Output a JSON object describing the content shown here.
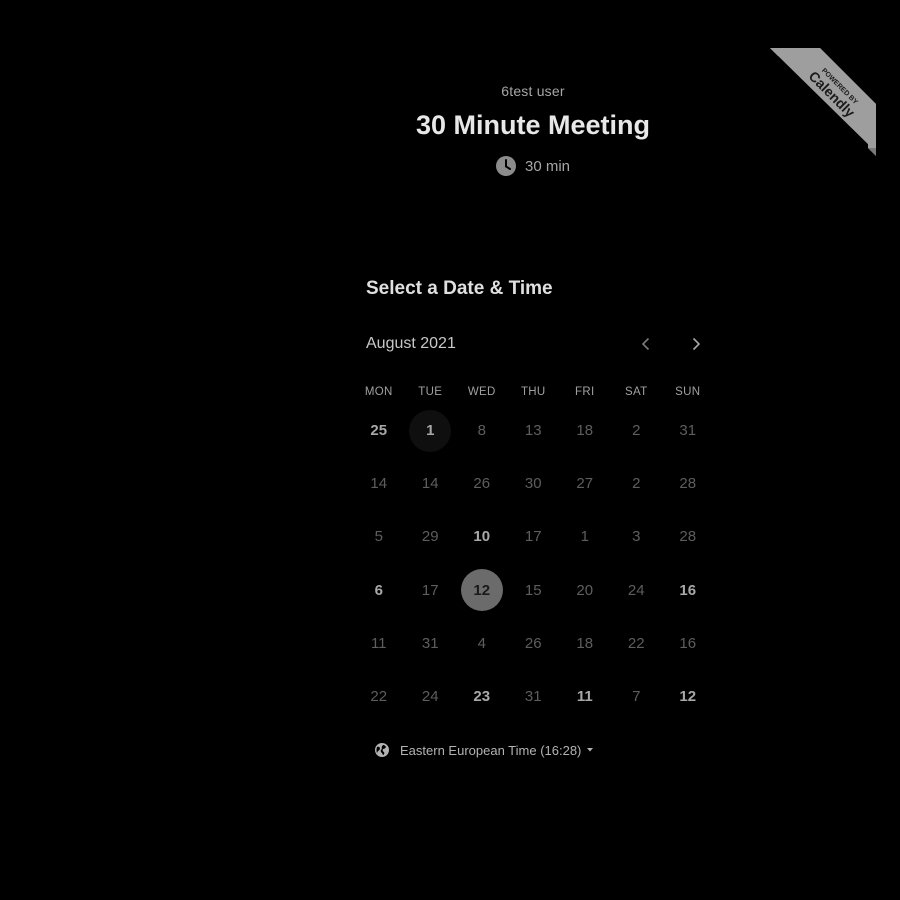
{
  "badge": {
    "line1": "POWERED BY",
    "line2": "Calendly",
    "color": "#9e9e9e"
  },
  "header": {
    "organizer": "6test user",
    "title": "30 Minute Meeting",
    "duration": "30 min",
    "duration_icon": "clock-icon"
  },
  "calendar": {
    "section_title": "Select a Date & Time",
    "month_label": "August 2021",
    "prev_icon": "chevron-left-icon",
    "next_icon": "chevron-right-icon",
    "weekdays": [
      "MON",
      "TUE",
      "WED",
      "THU",
      "FRI",
      "SAT",
      "SUN"
    ],
    "weeks": [
      [
        {
          "label": "25",
          "available": true
        },
        {
          "label": "1",
          "available": true,
          "today": true
        },
        {
          "label": "8",
          "available": false
        },
        {
          "label": "13",
          "available": false
        },
        {
          "label": "18",
          "available": false
        },
        {
          "label": "2",
          "available": false
        },
        {
          "label": "31",
          "available": false
        }
      ],
      [
        {
          "label": "14",
          "available": false
        },
        {
          "label": "14",
          "available": false
        },
        {
          "label": "26",
          "available": false
        },
        {
          "label": "30",
          "available": false
        },
        {
          "label": "27",
          "available": false
        },
        {
          "label": "2",
          "available": false
        },
        {
          "label": "28",
          "available": false
        }
      ],
      [
        {
          "label": "5",
          "available": false
        },
        {
          "label": "29",
          "available": false
        },
        {
          "label": "10",
          "available": true
        },
        {
          "label": "17",
          "available": false
        },
        {
          "label": "1",
          "available": false
        },
        {
          "label": "3",
          "available": false
        },
        {
          "label": "28",
          "available": false
        }
      ],
      [
        {
          "label": "6",
          "available": true
        },
        {
          "label": "17",
          "available": false
        },
        {
          "label": "12",
          "available": true,
          "selected": true
        },
        {
          "label": "15",
          "available": false
        },
        {
          "label": "20",
          "available": false
        },
        {
          "label": "24",
          "available": false
        },
        {
          "label": "16",
          "available": true
        }
      ],
      [
        {
          "label": "11",
          "available": false
        },
        {
          "label": "31",
          "available": false
        },
        {
          "label": "4",
          "available": false
        },
        {
          "label": "26",
          "available": false
        },
        {
          "label": "18",
          "available": false
        },
        {
          "label": "22",
          "available": false
        },
        {
          "label": "16",
          "available": false
        }
      ],
      [
        {
          "label": "22",
          "available": false
        },
        {
          "label": "24",
          "available": false
        },
        {
          "label": "23",
          "available": true
        },
        {
          "label": "31",
          "available": false
        },
        {
          "label": "11",
          "available": true
        },
        {
          "label": "7",
          "available": false
        },
        {
          "label": "12",
          "available": true
        }
      ]
    ]
  },
  "timezone": {
    "label": "Eastern European Time (16:28)",
    "icon": "globe-icon",
    "dropdown_icon": "caret-down-icon"
  },
  "colors": {
    "background": "#000000",
    "selected_day": "#6b6b6b",
    "available_day": "#a8a8a8",
    "unavailable_day": "#5e5e5e"
  }
}
